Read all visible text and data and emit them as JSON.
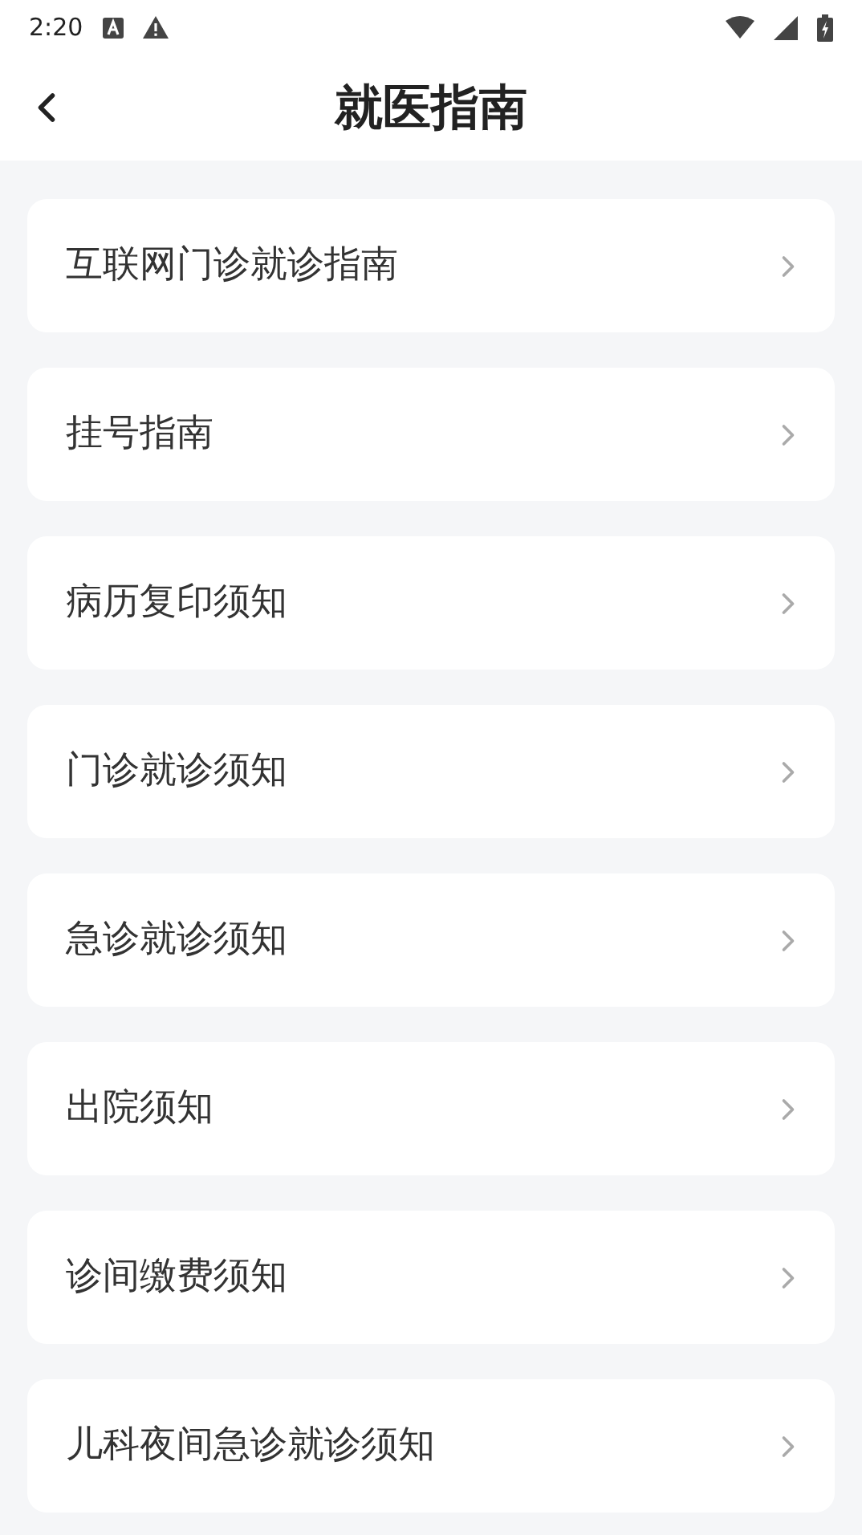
{
  "status_bar": {
    "time": "2:20"
  },
  "header": {
    "title": "就医指南"
  },
  "items": [
    {
      "label": "互联网门诊就诊指南"
    },
    {
      "label": "挂号指南"
    },
    {
      "label": "病历复印须知"
    },
    {
      "label": "门诊就诊须知"
    },
    {
      "label": "急诊就诊须知"
    },
    {
      "label": "出院须知"
    },
    {
      "label": "诊间缴费须知"
    },
    {
      "label": "儿科夜间急诊就诊须知"
    }
  ]
}
